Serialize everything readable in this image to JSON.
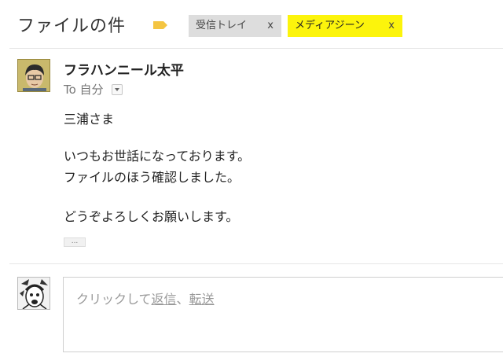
{
  "thread": {
    "subject": "ファイルの件",
    "labels": [
      {
        "text": "受信トレイ",
        "remove": "x"
      },
      {
        "text": "メディアジーン",
        "remove": "x"
      }
    ]
  },
  "message": {
    "sender": "フラハンニール太平",
    "recipient_line": "To 自分",
    "body": [
      "三浦さま",
      "いつもお世話になっております。",
      "ファイルのほう確認しました。",
      "どうぞよろしくお願いします。"
    ],
    "trimmed_content": "..."
  },
  "reply": {
    "prompt": "クリックして",
    "reply_link": "返信",
    "separator": "、",
    "forward_link": "転送"
  },
  "colors": {
    "label_inbox_bg": "#dddddd",
    "label_media_bg": "#fcf40c",
    "important_marker": "#f4c542"
  }
}
